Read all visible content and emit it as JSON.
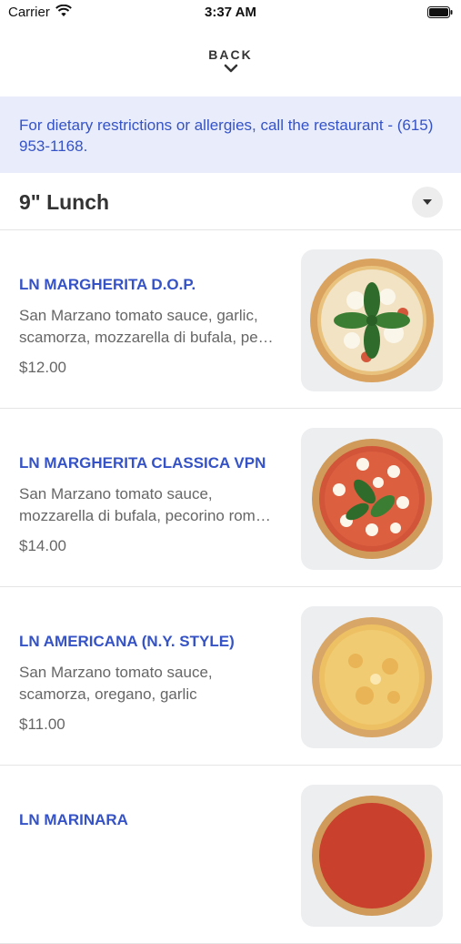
{
  "status_bar": {
    "carrier": "Carrier",
    "time": "3:37 AM"
  },
  "nav": {
    "back_label": "BACK"
  },
  "notice": {
    "text": "For dietary restrictions or allergies, call the restaurant - (615) 953-1168."
  },
  "section": {
    "title": "9\" Lunch"
  },
  "items": [
    {
      "name": "LN MARGHERITA D.O.P.",
      "description": "San Marzano tomato sauce, garlic, scamorza, mozzarella di bufala, pe…",
      "price": "$12.00",
      "image": "pizza-margherita-dop"
    },
    {
      "name": "LN MARGHERITA CLASSICA  VPN",
      "description": "San Marzano tomato sauce, mozzarella di bufala, pecorino rom…",
      "price": "$14.00",
      "image": "pizza-margherita-classica"
    },
    {
      "name": "LN AMERICANA (N.Y. STYLE)",
      "description": "San Marzano tomato sauce, scamorza, oregano, garlic",
      "price": "$11.00",
      "image": "pizza-americana"
    },
    {
      "name": "LN MARINARA",
      "description": "",
      "price": "",
      "image": "pizza-marinara"
    }
  ],
  "colors": {
    "accent": "#3553c6",
    "notice_bg": "#e8ecfb"
  }
}
